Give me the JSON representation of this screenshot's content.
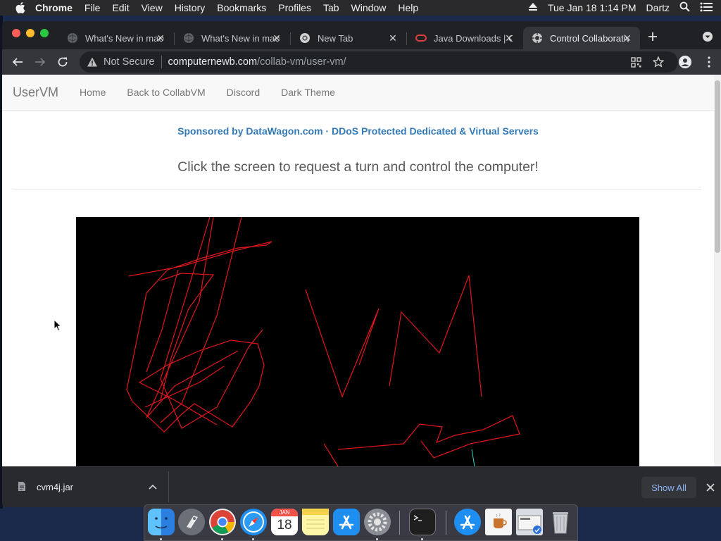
{
  "menubar": {
    "app_name": "Chrome",
    "items": [
      "File",
      "Edit",
      "View",
      "History",
      "Bookmarks",
      "Profiles",
      "Tab",
      "Window",
      "Help"
    ],
    "datetime": "Tue Jan 18  1:14 PM",
    "user": "Dartz"
  },
  "tabs": [
    {
      "title": "What's New in macOS",
      "active": false
    },
    {
      "title": "What's New in macOS",
      "active": false
    },
    {
      "title": "New Tab",
      "active": false
    },
    {
      "title": "Java Downloads | Oracle",
      "active": false
    },
    {
      "title": "Control Collaborative VM",
      "active": true
    }
  ],
  "omnibox": {
    "security_label": "Not Secure",
    "host": "computernewb.com",
    "path": "/collab-vm/user-vm/"
  },
  "page": {
    "brand": "UserVM",
    "nav_links": [
      "Home",
      "Back to CollabVM",
      "Discord",
      "Dark Theme"
    ],
    "sponsor": "Sponsored by DataWagon.com · DDoS Protected Dedicated & Virtual Servers",
    "headline": "Click the screen to request a turn and control the computer!"
  },
  "download_shelf": {
    "file_name": "cvm4j.jar",
    "show_all": "Show All"
  },
  "dock": {
    "calendar_month": "JAN",
    "calendar_day": "18"
  },
  "colors": {
    "link": "#337ab7",
    "vm_drawing": "#e0161b",
    "drawing_accent": "#35d0c8"
  }
}
